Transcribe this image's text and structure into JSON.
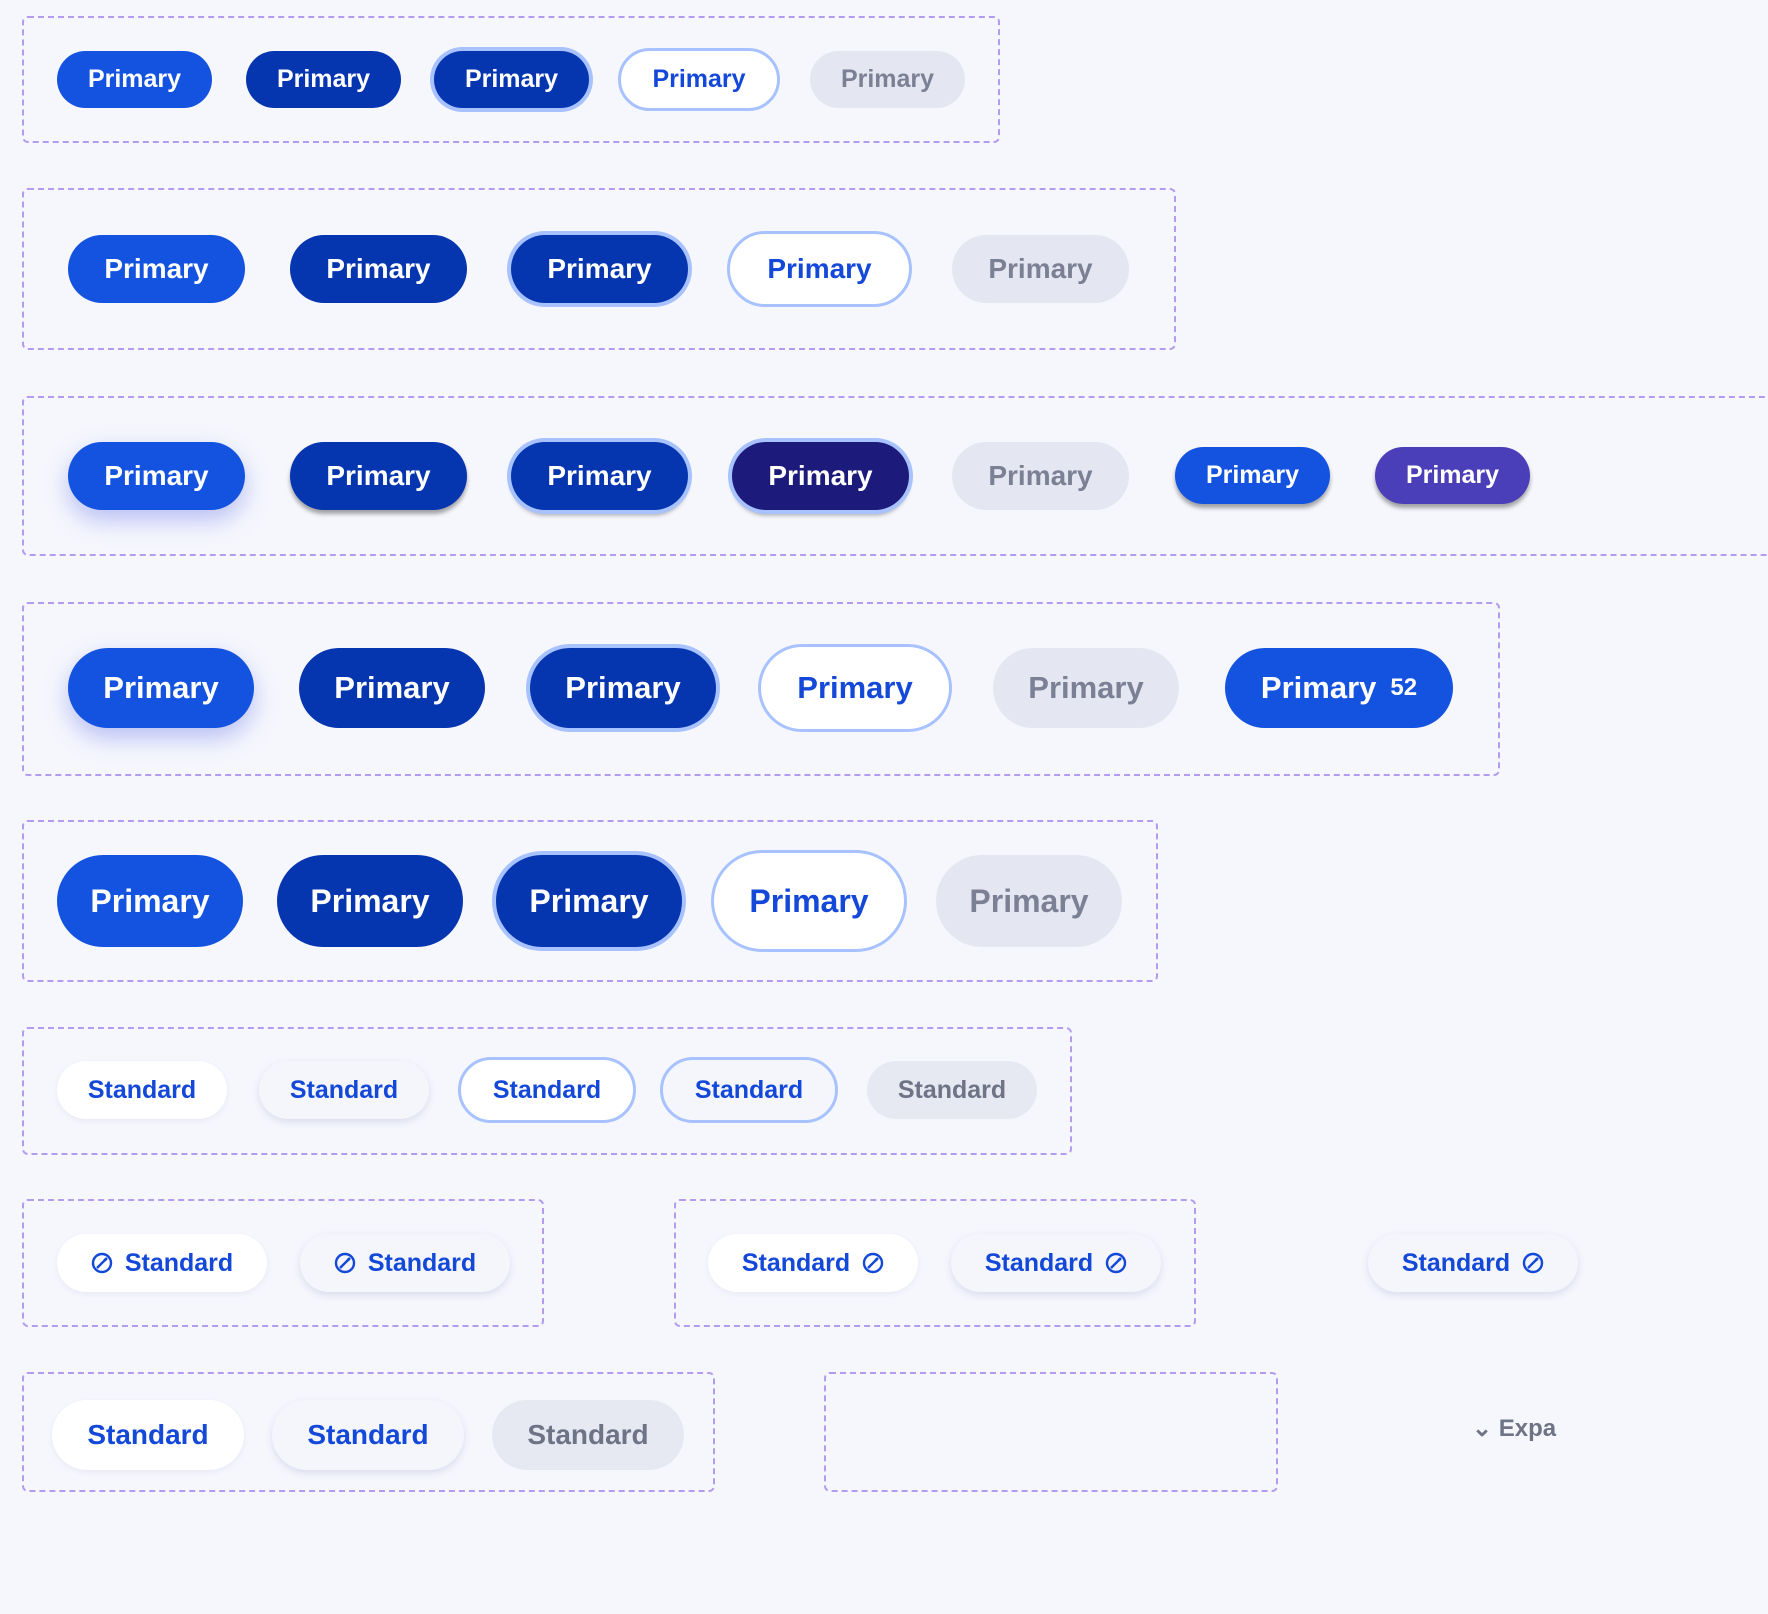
{
  "primary_label": "Primary",
  "standard_label": "Standard",
  "badge_count": "52",
  "partial_label": "Expa",
  "colors": {
    "primary": "#1453e0",
    "primary_dark": "#0635b0",
    "focus_ring": "#a7c2ff",
    "disabled_bg": "#e4e7f1",
    "violet": "#4a3fb8",
    "deep": "#1c1a7a",
    "frame": "#b39cf0"
  },
  "icons": {
    "edit": "edit-icon",
    "chevron": "chevron-down-icon"
  }
}
